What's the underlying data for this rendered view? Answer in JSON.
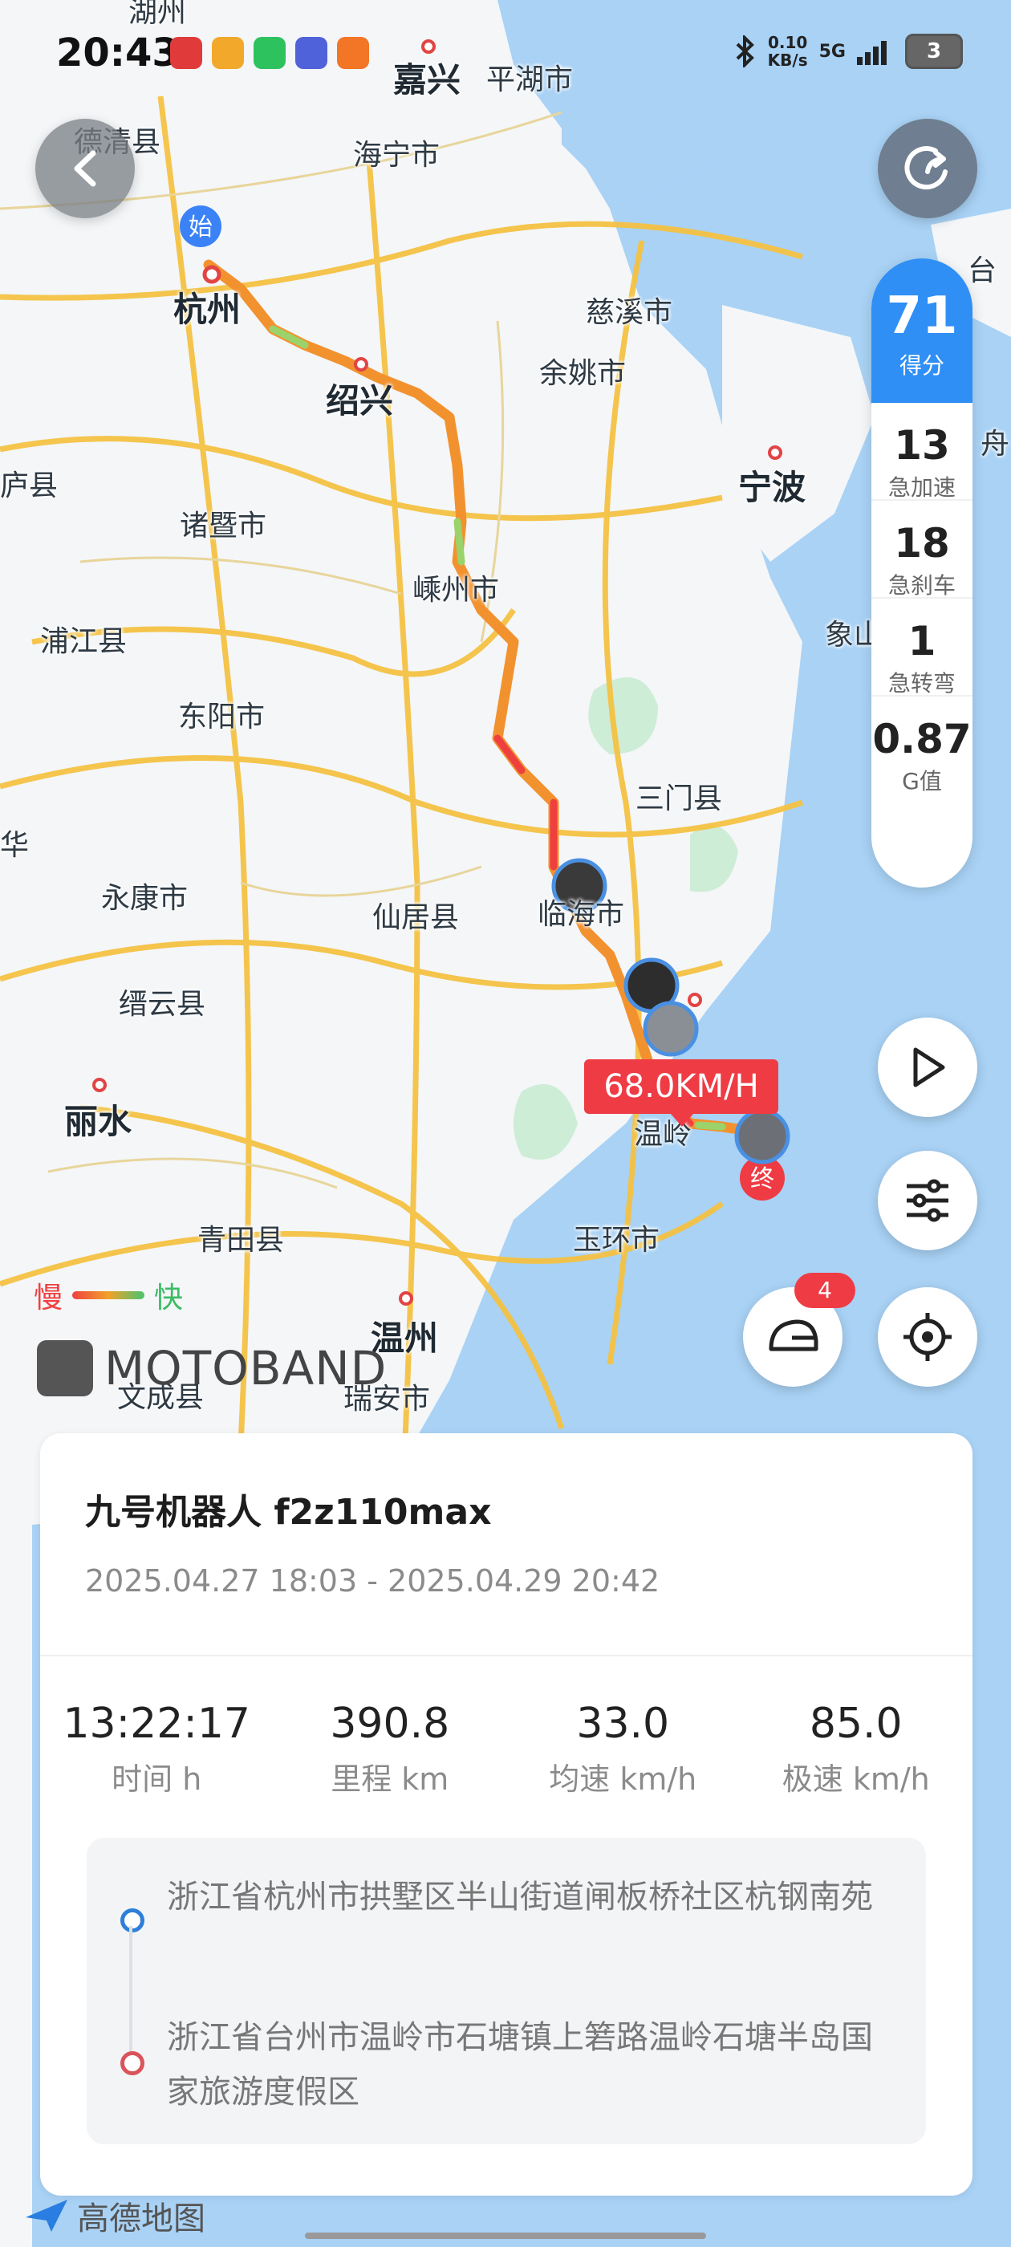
{
  "status_bar": {
    "time": "20:43",
    "net_speed": "0.10",
    "net_unit": "KB/s",
    "network": "5G",
    "battery": "3",
    "bluetooth_icon": "bluetooth-icon"
  },
  "map": {
    "labels": [
      "湖州",
      "嘉兴",
      "平湖市",
      "德清县",
      "海宁市",
      "杭州",
      "慈溪市",
      "余姚市",
      "绍兴",
      "宁波",
      "诸暨市",
      "嵊州市",
      "浦江县",
      "东阳市",
      "三门县",
      "永康市",
      "仙居县",
      "临海市",
      "缙云县",
      "丽水",
      "温岭",
      "玉环市",
      "青田县",
      "温州",
      "瑞安市",
      "文成县",
      "象山",
      "台",
      "舟",
      "华",
      "庐县"
    ],
    "start_marker": "始",
    "end_marker": "终",
    "speed_tag": "68.0KM/H",
    "legend_slow": "慢",
    "legend_fast": "快",
    "brand": "MOTOBAND",
    "map_provider": "高德地图",
    "colors": {
      "route_slow": "#ef4040",
      "route_mid": "#f2a12a",
      "route_fast": "#49c46f",
      "water": "#a9d2f5",
      "road": "#f4c243",
      "land": "#f4f6f8"
    }
  },
  "score_panel": {
    "score": "71",
    "score_label": "得分",
    "metrics": [
      {
        "value": "13",
        "label": "急加速"
      },
      {
        "value": "18",
        "label": "急刹车"
      },
      {
        "value": "1",
        "label": "急转弯"
      },
      {
        "value": "0.87",
        "label": "G值"
      }
    ]
  },
  "controls": {
    "back_icon": "chevron-left-icon",
    "share_icon": "share-icon",
    "play_icon": "play-icon",
    "settings_icon": "sliders-icon",
    "helmet_icon": "helmet-icon",
    "helmet_badge": "4",
    "locate_icon": "locate-icon"
  },
  "trip": {
    "vehicle": "九号机器人 f2z110max",
    "date_range": "2025.04.27 18:03 - 2025.04.29 20:42",
    "stats": [
      {
        "value": "13:22:17",
        "unit": "时间 h"
      },
      {
        "value": "390.8",
        "unit": "里程 km"
      },
      {
        "value": "33.0",
        "unit": "均速 km/h"
      },
      {
        "value": "85.0",
        "unit": "极速 km/h"
      }
    ],
    "start_address": "浙江省杭州市拱墅区半山街道闸板桥社区杭钢南苑",
    "end_address": "浙江省台州市温岭市石塘镇上箬路温岭石塘半岛国家旅游度假区"
  }
}
